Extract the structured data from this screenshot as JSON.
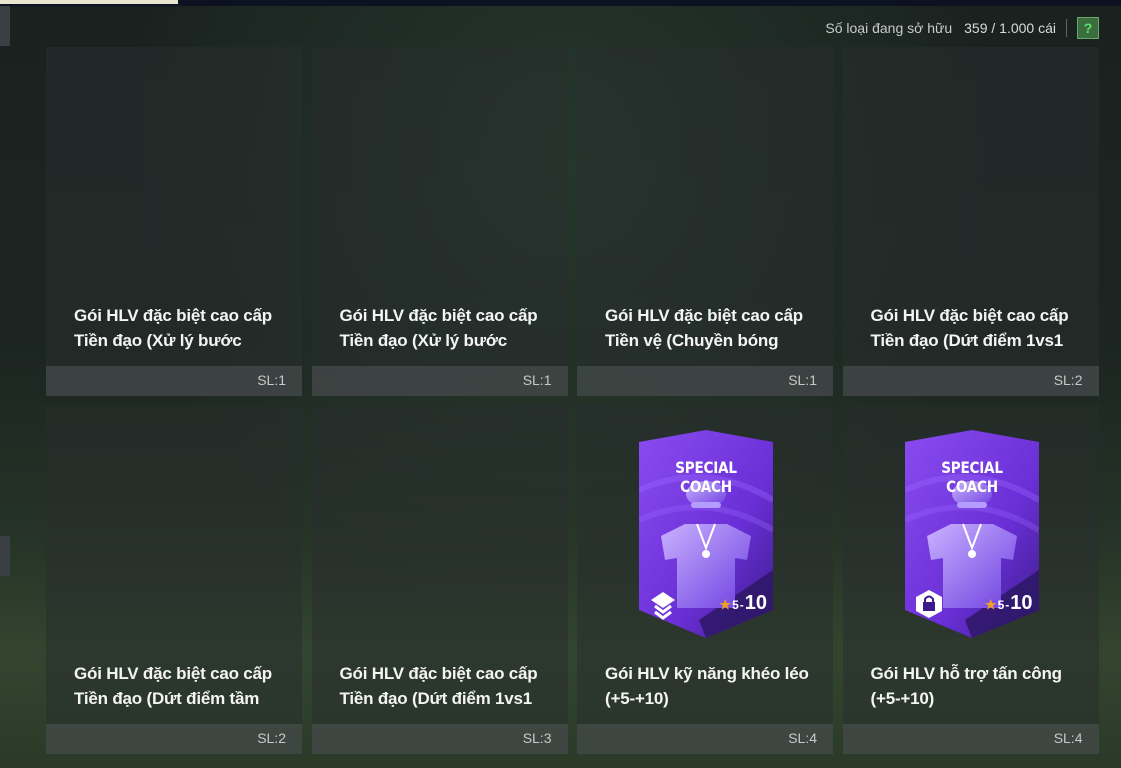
{
  "header": {
    "owned_label": "Số loại đang sở hữu",
    "owned_count": "359 / 1.000 cái",
    "help_label": "?"
  },
  "cards": [
    {
      "name": "Gói HLV đặc biệt cao cấp\nTiền đạo (Xử lý bước",
      "qty": "SL:1",
      "has_image": false
    },
    {
      "name": "Gói HLV đặc biệt cao cấp\nTiền đạo (Xử lý bước",
      "qty": "SL:1",
      "has_image": false
    },
    {
      "name": "Gói HLV đặc biệt cao cấp\nTiền vệ (Chuyền bóng",
      "qty": "SL:1",
      "has_image": false
    },
    {
      "name": "Gói HLV đặc biệt cao cấp\nTiền đạo (Dứt điểm 1vs1",
      "qty": "SL:2",
      "has_image": false
    },
    {
      "name": "Gói HLV đặc biệt cao cấp\nTiền đạo (Dứt điểm tầm",
      "qty": "SL:2",
      "has_image": false
    },
    {
      "name": "Gói HLV đặc biệt cao cấp\nTiền đạo (Dứt điểm 1vs1",
      "qty": "SL:3",
      "has_image": false
    },
    {
      "name": "Gói HLV kỹ năng khéo léo\n(+5-+10)",
      "qty": "SL:4",
      "has_image": true,
      "coach_title": "SPECIAL COACH",
      "rating_low": "5",
      "rating_high": "10",
      "badge_icon": "dribble-skill-icon"
    },
    {
      "name": "Gói HLV hỗ trợ tấn công\n(+5-+10)",
      "qty": "SL:4",
      "has_image": true,
      "coach_title": "SPECIAL COACH",
      "rating_low": "5",
      "rating_high": "10",
      "badge_icon": "attack-support-icon"
    }
  ],
  "colors": {
    "accent_green": "#62e26a",
    "coach_purple": "#7b3fe0"
  }
}
